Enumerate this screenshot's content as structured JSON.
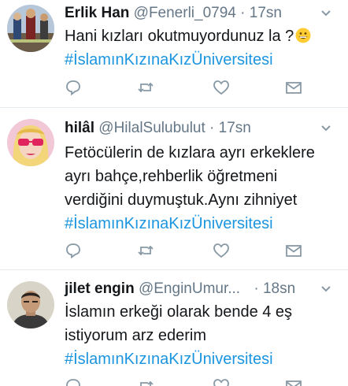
{
  "tweets": [
    {
      "name": "Erlik Han",
      "handle": "@Fenerli_0794",
      "separator": "·",
      "time": "17sn",
      "text": [
        "Hani kızları okutmuyordunuz la ?"
      ],
      "emoji": "grinning-face",
      "hashtag": "#İslamınKızınaKızÜniversitesi",
      "avatar": "avatar-image-icon"
    },
    {
      "name": "hilâl",
      "handle": "@HilalSulubulut",
      "separator": "·",
      "time": "17sn",
      "text": [
        "Fetöcülerin de kızlara ayrı erkeklere",
        "ayrı bahçe,rehberlik öğretmeni",
        "verdiğini duymuştuk.Aynı zihniyet"
      ],
      "hashtag": "#İslamınKızınaKızÜniversitesi",
      "avatar": "avatar-illustration-icon"
    },
    {
      "name": "jilet engin",
      "handle": "@EnginUmur...",
      "separator": "·",
      "time": "18sn",
      "text": [
        "İslamın erkeği olarak bende 4 eş",
        "istiyorum arz ederim"
      ],
      "hashtag": "#İslamınKızınaKızÜniversitesi",
      "avatar": "avatar-photo-icon"
    }
  ],
  "actions": [
    "reply-icon",
    "retweet-icon",
    "like-icon",
    "message-icon"
  ],
  "colors": {
    "hashtag": "#1b95e0",
    "secondary_text": "#657786",
    "icon": "#8899a6",
    "divider": "#e6ecf0"
  }
}
